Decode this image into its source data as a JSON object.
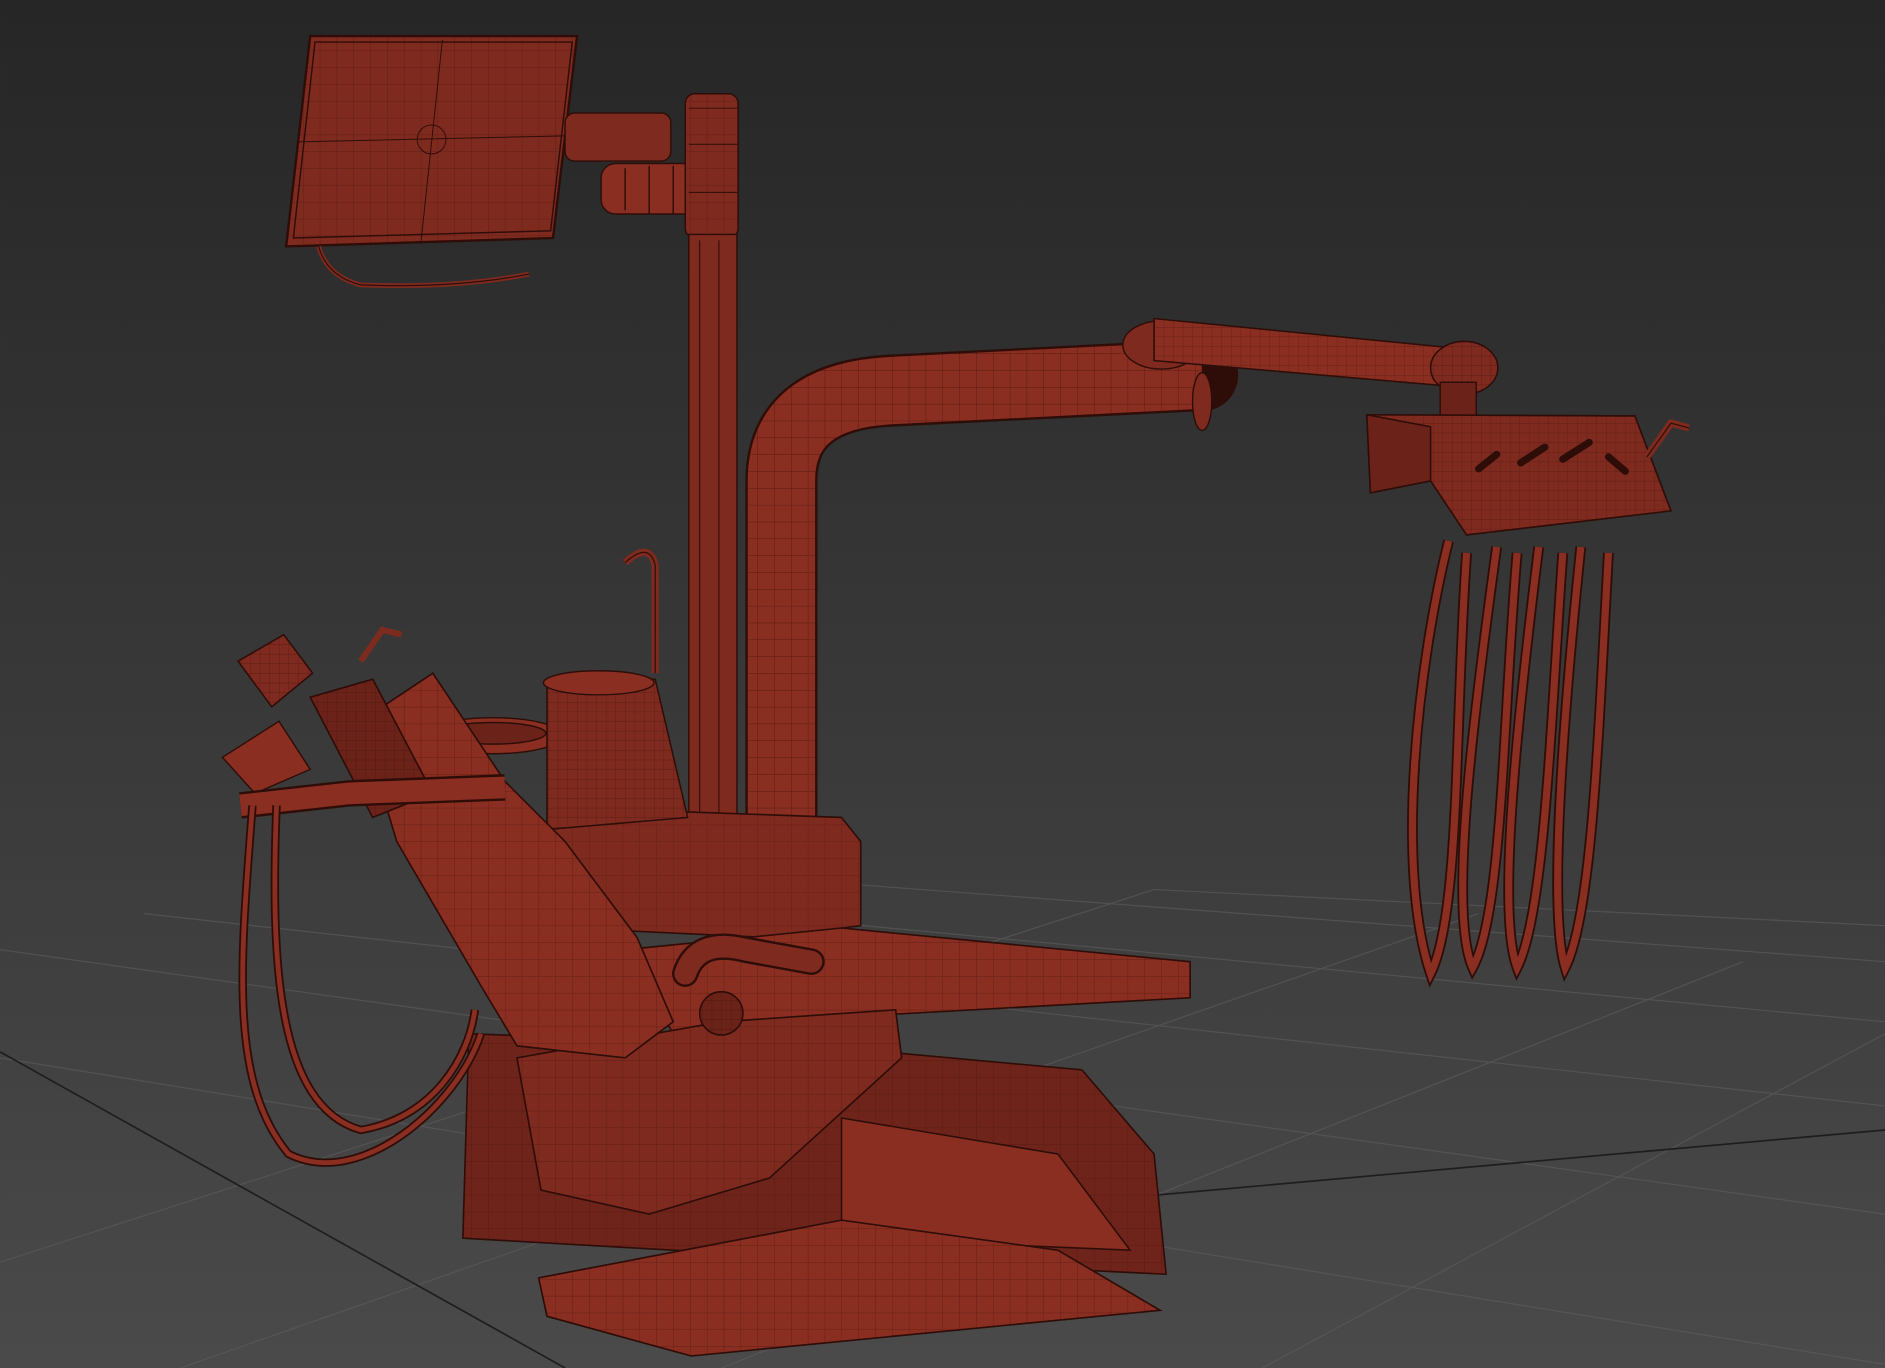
{
  "viewport": {
    "background_top": "#262626",
    "background_bottom": "#4a4a4a",
    "grid_color": "#5e5e5e",
    "grid_axis_color": "#1e1e1e",
    "shading_mode": "wireframe-on-shaded"
  },
  "model": {
    "subject": "dental-chair-unit",
    "base_color": "#7f2a1f",
    "light_color": "#9a3627",
    "dark_color": "#5a1a12",
    "wire_color": "#2e0d08",
    "parts": [
      "monitor",
      "monitor-arm",
      "support-column",
      "light-arm",
      "instrument-arm",
      "instrument-tray",
      "handpiece-hoses",
      "spittoon-bowl",
      "water-cup-holder",
      "headrest",
      "backrest",
      "seat",
      "armrest",
      "leg-rest",
      "chair-base",
      "foot-plate",
      "left-side-hoses"
    ]
  }
}
